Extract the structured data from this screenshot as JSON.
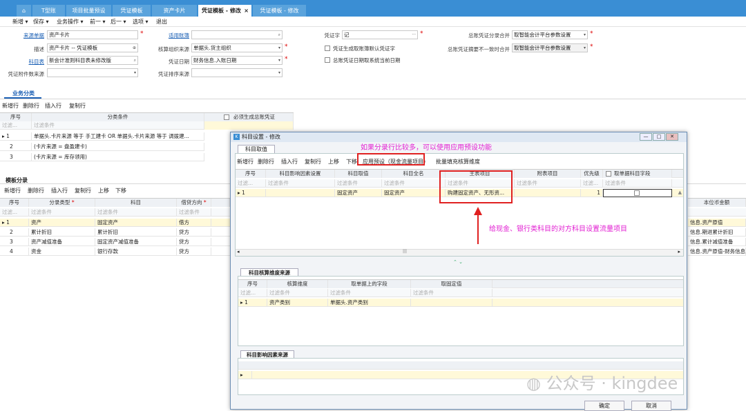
{
  "tabs": [
    {
      "label": ""
    },
    {
      "label": "T型账"
    },
    {
      "label": "项目批量预设"
    },
    {
      "label": "凭证模板"
    },
    {
      "label": "资产卡片"
    },
    {
      "label": "凭证模板 - 修改"
    },
    {
      "label": "凭证模板 - 修改"
    }
  ],
  "active_tab_close": "×",
  "menu": [
    "新增 ▾",
    "保存 ▾",
    "业务操作 ▾",
    "前一 ▾",
    "后一 ▾",
    "选项 ▾",
    "退出"
  ],
  "form": {
    "source_doc_label": "来源单据",
    "source_doc_value": "资产卡片",
    "desc_label": "描述",
    "desc_value": "资产卡片 -- 凭证模板",
    "acct_table_label": "科目表",
    "acct_table_value": "新会计准则科目表未修改版",
    "attach_src_label": "凭证附件数来源",
    "book_label": "适用账簿",
    "book_value": "",
    "org_label": "核算组织来源",
    "org_value": "单据头.货主组织",
    "date_label": "凭证日期",
    "date_value": "财务信息.入账日期",
    "sort_label": "凭证排序来源",
    "voucher_word_label": "凭证字",
    "voucher_word_value": "记",
    "chk1": "凭证生成取账簿默认凭证字",
    "chk2": "总账凭证日期取系统当前日期",
    "merge_label": "总账凭证分录合并",
    "merge_value": "取智能会计平台参数设置",
    "summary_label": "总账凭证摘要不一致时合并",
    "summary_value": "取智能会计平台参数设置"
  },
  "biz_section": {
    "title": "业务分类",
    "toolbar": [
      "新增行",
      "删除行",
      "插入行",
      "复制行"
    ],
    "headers": [
      "序号",
      "分类条件",
      "必须生成总账凭证"
    ],
    "filter": [
      "过滤...",
      "过滤条件"
    ],
    "rows": [
      {
        "no": "1",
        "cond": "单据头.卡片来源 等于 手工建卡  OR  单据头.卡片来源 等于 调拨建..."
      },
      {
        "no": "2",
        "cond": "(卡片来源 = 盘盈建卡)"
      },
      {
        "no": "3",
        "cond": "(卡片来源 = 库存领用)"
      }
    ]
  },
  "tpl_section": {
    "title": "模板分录",
    "toolbar": [
      "新增行",
      "删除行",
      "插入行",
      "复制行",
      "上移",
      "下移"
    ],
    "headers": [
      "序号",
      "分录类型",
      "科目",
      "借贷方向",
      "本位币金额"
    ],
    "filter": [
      "过滤...",
      "过滤条件",
      "过滤条件",
      "过滤条件"
    ],
    "rows": [
      {
        "no": "1",
        "type": "资产",
        "acct": "固定资产",
        "dir": "借方",
        "amt": "信息.资产原值"
      },
      {
        "no": "2",
        "type": "累计折旧",
        "acct": "累计折旧",
        "dir": "贷方",
        "amt": "信息.期进累计折旧"
      },
      {
        "no": "3",
        "type": "资产减值准备",
        "acct": "固定资产减值准备",
        "dir": "贷方",
        "amt": "信息.累计减值准备"
      },
      {
        "no": "4",
        "type": "资金",
        "acct": "银行存款",
        "dir": "贷方",
        "amt": "信息.资产原值-财务信息"
      }
    ]
  },
  "dialog": {
    "title": "科目设置 - 修改",
    "tab": "科目取值",
    "toolbar": [
      "新增行",
      "删除行",
      "插入行",
      "复制行",
      "上移",
      "下移",
      "应用预设（现金流量项目）",
      "批量填充核算维度"
    ],
    "headers": [
      "序号",
      "科目影响因素设置",
      "科目取值",
      "科目全名",
      "主表项目",
      "附表项目",
      "优先级",
      "取单据科目字段"
    ],
    "filter": [
      "过滤...",
      "过滤条件",
      "过滤条件",
      "过滤条件",
      "过滤条件",
      "过滤条件",
      "过滤...",
      "过滤条件"
    ],
    "row": {
      "no": "1",
      "factor": "",
      "value": "固定资产",
      "fullname": "固定资产",
      "main": "购建固定资产、无形资...",
      "sub": "",
      "prio": "1"
    },
    "dim_title": "科目核算维度来源",
    "dim_headers": [
      "序号",
      "核算维度",
      "取单据上的字段",
      "取固定值"
    ],
    "dim_filter": [
      "过滤...",
      "过滤条件",
      "过滤条件",
      "过滤条件"
    ],
    "dim_row": {
      "no": "1",
      "dim": "资产类别",
      "field": "单据头.资产类别",
      "fixed": ""
    },
    "factor_title": "科目影响因素来源",
    "ok": "确定",
    "cancel": "取消"
  },
  "annotations": {
    "top": "如果分录行比较多，可以使用应用预设功能",
    "right": "给现金、银行类科目的对方科目设置流量项目"
  },
  "watermark": "公众号 · kingdee",
  "colors": {
    "tabbar": "#3a8ed4",
    "annotation": "#e21fd2",
    "highlight": "#e02020"
  }
}
